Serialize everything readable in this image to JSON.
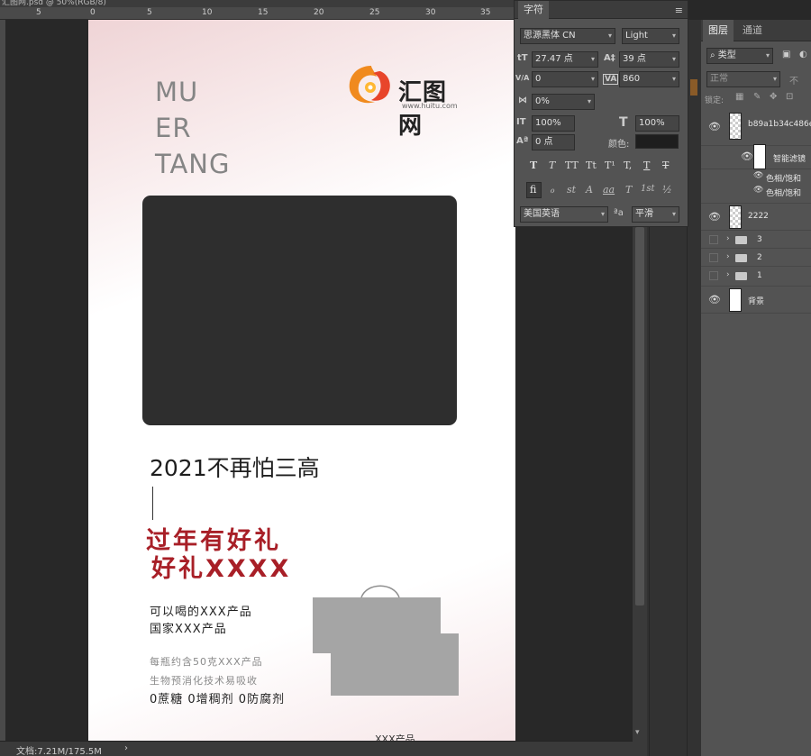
{
  "window": {
    "doc_title": "汇图网.psd @ 50%(RGB/8)"
  },
  "ruler": {
    "labels": [
      "5",
      "0",
      "5",
      "10",
      "15",
      "20",
      "25",
      "30",
      "35"
    ]
  },
  "poster": {
    "brand_lines": [
      "MU",
      "ER",
      "TANG"
    ],
    "logo_text": "汇图网",
    "logo_url": "www.huitu.com",
    "headline": "2021不再怕三高",
    "promo_lines": [
      "过年有好礼",
      "好礼XXXX"
    ],
    "product_lines": [
      "可以喝的XXX产品",
      "国家XXX产品"
    ],
    "detail_lines": [
      "每瓶约含50克XXX产品",
      "生物预消化技术易吸收"
    ],
    "zero_line": "0蔗糖 0增稠剂 0防腐剂",
    "footer_text": "XXX产品"
  },
  "status": {
    "doc_size": "文档:7.21M/175.5M",
    "arrow": "›"
  },
  "character_panel": {
    "tab": "字符",
    "font_family": "思源黑体 CN",
    "font_style": "Light",
    "font_size": "27.47 点",
    "leading": "39 点",
    "kerning": "0",
    "tracking": "860",
    "tsume": "0%",
    "vertical_scale": "100%",
    "horizontal_scale": "100%",
    "baseline_shift": "0 点",
    "color_label": "颜色:",
    "style_buttons": [
      "T",
      "T",
      "TT",
      "Tt",
      "T¹",
      "T,",
      "T",
      "T"
    ],
    "opentype_buttons": [
      "fi",
      "ℴ",
      "st",
      "A",
      "aa",
      "T",
      "1st",
      "½"
    ],
    "language": "美国英语",
    "aa_icon": "ªa",
    "anti_alias": "平滑",
    "icons": {
      "size": "tT",
      "leading": "A‡",
      "kerning": "V/A",
      "tracking": "VA",
      "tsume": "⋈",
      "vscale": "IT",
      "hscale": "T",
      "baseline": "Aª"
    }
  },
  "layers_panel": {
    "tabs": [
      "图层",
      "通道"
    ],
    "filter_kind": "类型",
    "blend_mode": "正常",
    "opacity_short": "不",
    "lock_label": "锁定:",
    "layers": [
      {
        "name": "b89a1b34c486e",
        "visible": true
      },
      {
        "name": "智能滤镜",
        "visible": true
      },
      {
        "name": "色相/饱和",
        "visible": true
      },
      {
        "name": "色相/饱和",
        "visible": true
      },
      {
        "name": "2222",
        "visible": true
      },
      {
        "name": "3",
        "visible": false
      },
      {
        "name": "2",
        "visible": false
      },
      {
        "name": "1",
        "visible": false
      },
      {
        "name": "背景",
        "visible": true
      }
    ]
  },
  "colors": {
    "promo_red": "#a81f27",
    "poster_pink": "#efd4d6",
    "photo_placeholder": "#2e2e2e",
    "panel_bg": "#535353",
    "canvas_bg": "#282828"
  }
}
